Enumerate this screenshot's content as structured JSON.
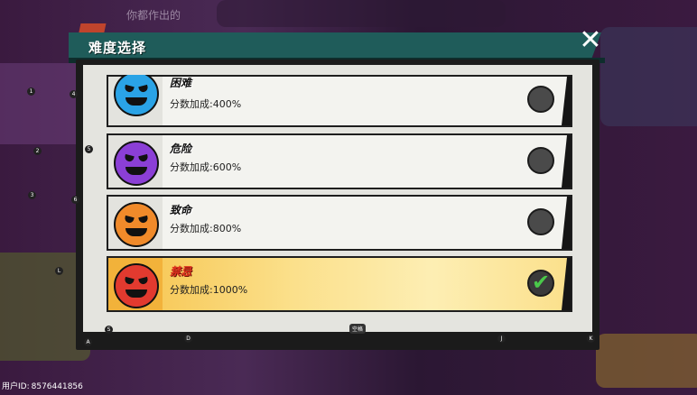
{
  "dialog": {
    "title": "难度选择",
    "close_icon": "close-icon"
  },
  "background": {
    "top_text": "你都作出的"
  },
  "difficulties": [
    {
      "name": "困难",
      "bonus": "分数加成:400%",
      "color": "#2aa3e6",
      "selected": false
    },
    {
      "name": "危险",
      "bonus": "分数加成:600%",
      "color": "#8b3fd6",
      "selected": false
    },
    {
      "name": "致命",
      "bonus": "分数加成:800%",
      "color": "#f08a2a",
      "selected": false
    },
    {
      "name": "禁忌",
      "bonus": "分数加成:1000%",
      "color": "#e23a2f",
      "selected": true
    }
  ],
  "footer": {
    "user_id_label": "用户ID:",
    "user_id_value": "8576441856",
    "tag": "空格"
  },
  "hotkeys": [
    "1",
    "2",
    "3",
    "4",
    "5",
    "6",
    "L",
    "S",
    "A",
    "D",
    "J",
    "K"
  ]
}
